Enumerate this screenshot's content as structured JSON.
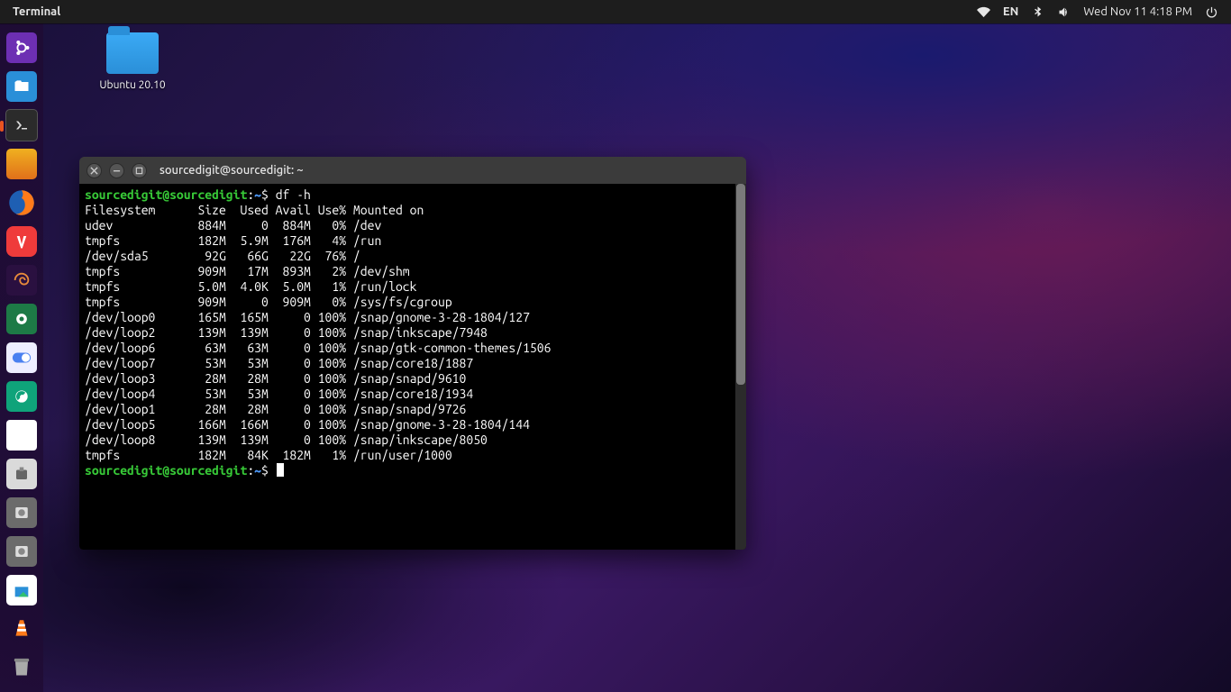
{
  "topbar": {
    "app": "Terminal",
    "lang": "EN",
    "clock": "Wed Nov 11  4:18 PM"
  },
  "desktop": {
    "folder_label": "Ubuntu 20.10"
  },
  "dock": {
    "items": [
      {
        "n": "ubuntu-logo",
        "running": false
      },
      {
        "n": "files",
        "running": false
      },
      {
        "n": "terminal",
        "running": true
      },
      {
        "n": "color-picker",
        "running": false
      },
      {
        "n": "firefox",
        "running": false
      },
      {
        "n": "vivaldi",
        "running": false
      },
      {
        "n": "swirl-app",
        "running": false
      },
      {
        "n": "screenshot",
        "running": false
      },
      {
        "n": "toggle-app",
        "running": false
      },
      {
        "n": "tweaks",
        "running": false
      },
      {
        "n": "notes",
        "running": false
      },
      {
        "n": "archive",
        "running": false
      },
      {
        "n": "disk-a",
        "running": false
      },
      {
        "n": "disk-b",
        "running": false
      },
      {
        "n": "software",
        "running": false
      },
      {
        "n": "vlc",
        "running": false
      }
    ]
  },
  "terminal": {
    "title": "sourcedigit@sourcedigit: ~",
    "prompt_user": "sourcedigit@sourcedigit",
    "prompt_sep": ":",
    "prompt_path": "~",
    "prompt_char": "$",
    "command": "df -h",
    "header": "Filesystem      Size  Used Avail Use% Mounted on",
    "rows": [
      "udev            884M     0  884M   0% /dev",
      "tmpfs           182M  5.9M  176M   4% /run",
      "/dev/sda5        92G   66G   22G  76% /",
      "tmpfs           909M   17M  893M   2% /dev/shm",
      "tmpfs           5.0M  4.0K  5.0M   1% /run/lock",
      "tmpfs           909M     0  909M   0% /sys/fs/cgroup",
      "/dev/loop0      165M  165M     0 100% /snap/gnome-3-28-1804/127",
      "/dev/loop2      139M  139M     0 100% /snap/inkscape/7948",
      "/dev/loop6       63M   63M     0 100% /snap/gtk-common-themes/1506",
      "/dev/loop7       53M   53M     0 100% /snap/core18/1887",
      "/dev/loop3       28M   28M     0 100% /snap/snapd/9610",
      "/dev/loop4       53M   53M     0 100% /snap/core18/1934",
      "/dev/loop1       28M   28M     0 100% /snap/snapd/9726",
      "/dev/loop5      166M  166M     0 100% /snap/gnome-3-28-1804/144",
      "/dev/loop8      139M  139M     0 100% /snap/inkscape/8050",
      "tmpfs           182M   84K  182M   1% /run/user/1000"
    ]
  }
}
